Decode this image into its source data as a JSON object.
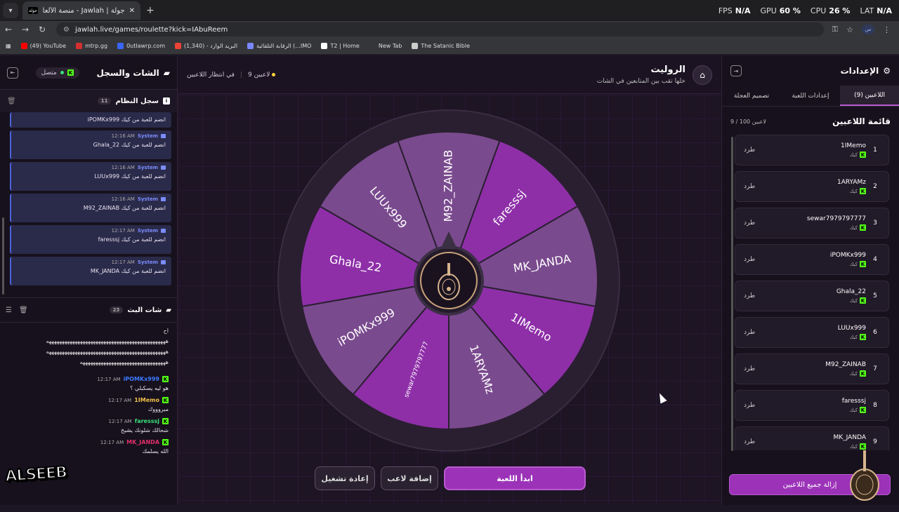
{
  "browser": {
    "tab_title": "جولة | Jawlah - منصة الألعاب الت...",
    "tab_favicon": "جولة",
    "new_tab": "+",
    "url": "jawlah.live/games/roulette?kick=IAbuReem",
    "profile": "س",
    "perf": [
      {
        "label": "FPS",
        "value": "N/A"
      },
      {
        "label": "GPU",
        "value": "60 %"
      },
      {
        "label": "CPU",
        "value": "26 %"
      },
      {
        "label": "LAT",
        "value": "N/A"
      }
    ],
    "bookmarks": [
      {
        "label": "(49) YouTube",
        "color": "#ff0000"
      },
      {
        "label": "mtrp.gg",
        "color": "#d4302f"
      },
      {
        "label": "0utlawrp.com",
        "color": "#3a66ff"
      },
      {
        "label": "البريد الوارد - (1,340)",
        "color": "#ea4335"
      },
      {
        "label": "الرقابة التلقائية (...IMO",
        "color": "#7a88ff"
      },
      {
        "label": "T2 | Home",
        "color": "#ffffff"
      },
      {
        "label": "New Tab",
        "color": "#35363a"
      },
      {
        "label": "The Satanic Bible",
        "color": "#cccccc"
      }
    ]
  },
  "chat_panel": {
    "title": "الشات والسجل",
    "status": "متصل",
    "system_log": {
      "title": "سجل النظام",
      "count": "11",
      "messages": [
        {
          "user": "System",
          "time": "",
          "text": "iPOMKx999 انضم للعبة من كيك"
        },
        {
          "user": "System",
          "time": "12:16 AM",
          "text": "Ghala_22 انضم للعبة من كيك"
        },
        {
          "user": "System",
          "time": "12:16 AM",
          "text": "LUUx999 انضم للعبة من كيك"
        },
        {
          "user": "System",
          "time": "12:16 AM",
          "text": "M92_ZAINAB انضم للعبة من كيك"
        },
        {
          "user": "System",
          "time": "12:17 AM",
          "text": "faresssj انضم للعبة من كيك"
        },
        {
          "user": "System",
          "time": "12:17 AM",
          "text": "MK_JANDA انضم للعبة من كيك"
        }
      ]
    },
    "live_chat": {
      "title": "شات البث",
      "count": "23",
      "spam_top": "اح",
      "spam_lines": [
        "ههههههههههههههههههههههههههههههههههههههههههههههه",
        "ههههههههههههههههههههههههههههههههههههههههههههههه",
        "هههههههههههههههههههههههههههههههههه"
      ],
      "messages": [
        {
          "user": "iPOMKx999",
          "color": "#3b7bff",
          "time": "12:17 AM",
          "text": "هو ليه يسكبلي ؟"
        },
        {
          "user": "1IMemo",
          "color": "#f0c24a",
          "time": "12:17 AM",
          "text": "مبروووك"
        },
        {
          "user": "faresssj",
          "color": "#3ae07a",
          "time": "12:17 AM",
          "text": "شحالك شلونك يشيخ"
        },
        {
          "user": "MK_JANDA",
          "color": "#e0306a",
          "time": "12:17 AM",
          "text": "الله يسلمك"
        }
      ]
    },
    "watermark": "ALSEEB"
  },
  "center": {
    "title": "الروليت",
    "subtitle": "خلها تقب بين المتابعين في الشات",
    "players_count": "9 لاعبين",
    "waiting": "في انتظار اللاعبين",
    "buttons": {
      "start": "ابدأ اللعبة",
      "add_player": "إضافة لاعب",
      "restart": "إعادة تشغيل"
    }
  },
  "wheel_data": {
    "slices": [
      "M92_ZAINAB",
      "faresssj",
      "MK_JANDA",
      "1IMemo",
      "1ARYAMz",
      "sewar7979797777",
      "iPOMKx999",
      "Ghala_22",
      "LUUx999"
    ],
    "colors": [
      "#7a4a8e",
      "#8e2fa8"
    ],
    "hub_icon": "oud-icon"
  },
  "settings": {
    "title": "الإعدادات",
    "tabs": [
      "اللاعبين (9)",
      "إعدادات اللعبة",
      "تصميم العجلة"
    ],
    "list_title": "قائمة اللاعبين",
    "list_count": "9 / 100 لاعبين",
    "kick_label": "طرد",
    "source_label": "كيك",
    "players": [
      {
        "num": "1",
        "name": "1IMemo"
      },
      {
        "num": "2",
        "name": "1ARYAMz"
      },
      {
        "num": "3",
        "name": "sewar7979797777"
      },
      {
        "num": "4",
        "name": "iPOMKx999"
      },
      {
        "num": "5",
        "name": "Ghala_22"
      },
      {
        "num": "6",
        "name": "LUUx999"
      },
      {
        "num": "7",
        "name": "M92_ZAINAB"
      },
      {
        "num": "8",
        "name": "faresssj"
      },
      {
        "num": "9",
        "name": "MK_JANDA"
      }
    ],
    "remove_all": "إزالة جميع اللاعبين"
  }
}
